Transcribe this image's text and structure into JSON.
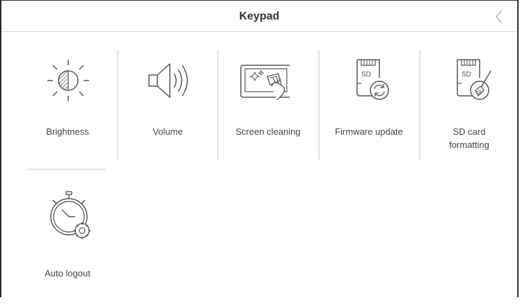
{
  "header": {
    "title": "Keypad",
    "back_icon": "chevron-left-icon"
  },
  "tiles": [
    {
      "label": "Brightness",
      "icon": "brightness-icon"
    },
    {
      "label": "Volume",
      "icon": "speaker-volume-icon"
    },
    {
      "label": "Screen cleaning",
      "icon": "screen-cleaning-icon"
    },
    {
      "label": "Firmware update",
      "icon": "sd-card-refresh-icon"
    },
    {
      "label": "SD card formatting",
      "icon": "sd-card-broom-icon"
    },
    {
      "label": "Auto logout",
      "icon": "stopwatch-gear-icon"
    }
  ],
  "colors": {
    "icon_stroke": "#555555",
    "separator": "#e2e2e2"
  }
}
